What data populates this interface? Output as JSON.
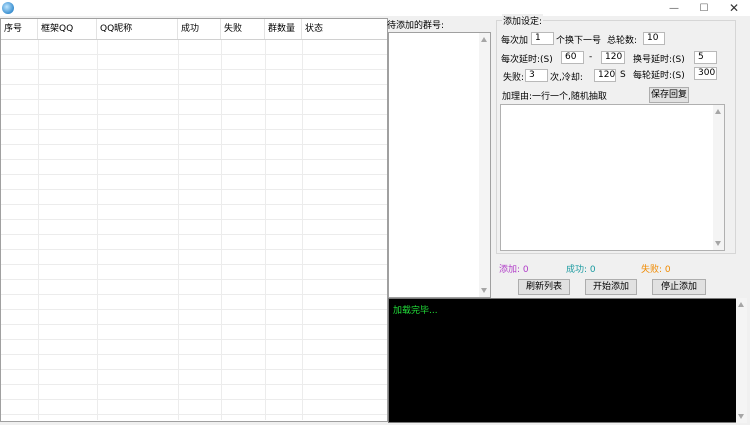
{
  "window": {
    "icon": "app-icon",
    "controls": {
      "minimize": "—",
      "maximize": "☐",
      "close": "✕"
    }
  },
  "table": {
    "columns": [
      "序号",
      "框架QQ",
      "QQ昵称",
      "成功",
      "失败",
      "群数量",
      "状态"
    ],
    "rows": []
  },
  "pending": {
    "label": "待添加的群号:"
  },
  "settings": {
    "legend": "添加设定:",
    "each_add_label": "每次加",
    "each_add_value": "1",
    "switch_next_label": "个换下一号",
    "total_rounds_label": "总轮数:",
    "total_rounds_value": "10",
    "delay_label": "每次延时:(S)",
    "delay_min": "60",
    "delay_sep": "-",
    "delay_max": "120",
    "switch_delay_label": "换号延时:(S)",
    "switch_delay_value": "5",
    "fail_label": "失败:",
    "fail_value": "3",
    "cooldown_label": "次,冷却:",
    "cooldown_value": "120",
    "cooldown_unit": "S",
    "round_delay_label": "每轮延时:(S)",
    "round_delay_value": "300",
    "reason_label": "加理由:一行一个,随机抽取",
    "save_reply_button": "保存回复",
    "reason_text": ""
  },
  "stats": {
    "added": "添加: 0",
    "success": "成功: 0",
    "fail": "失败: 0",
    "colors": {
      "added": "#b03cc8",
      "success": "#1a9aa0",
      "fail": "#f08a00"
    }
  },
  "actions": {
    "refresh": "刷新列表",
    "start": "开始添加",
    "stop": "停止添加"
  },
  "log": {
    "text": "加载完毕...",
    "color": "#22e03a"
  }
}
